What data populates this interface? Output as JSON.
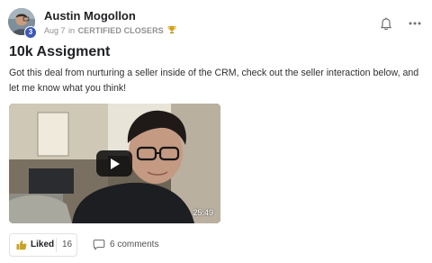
{
  "post": {
    "author": {
      "name": "Austin Mogollon",
      "level": "3",
      "avatar": "avatar-photo"
    },
    "meta": {
      "date": "Aug 7",
      "in_word": "in",
      "group": "CERTIFIED CLOSERS",
      "group_icon": "trophy-icon"
    },
    "actions": {
      "notify_icon": "bell-icon",
      "more_icon": "more-dots-icon"
    },
    "title": "10k Assigment",
    "body": "Got this deal from nurturing a seller inside of the CRM, check out the seller interaction below, and let me know what you think!",
    "video": {
      "duration": "25:49",
      "play_icon": "play-icon"
    },
    "reactions": {
      "like_label": "Liked",
      "like_count": "16",
      "like_icon": "thumbs-up-icon",
      "comments_label": "6 comments",
      "comment_icon": "comment-icon"
    }
  },
  "colors": {
    "text_primary": "#202124",
    "text_muted": "#909090",
    "badge_blue": "#3d57b8",
    "trophy_gold": "#d4a017",
    "like_gold": "#c9a227",
    "border": "#e2e2e2",
    "video_overlay": "#0f0f0f"
  }
}
